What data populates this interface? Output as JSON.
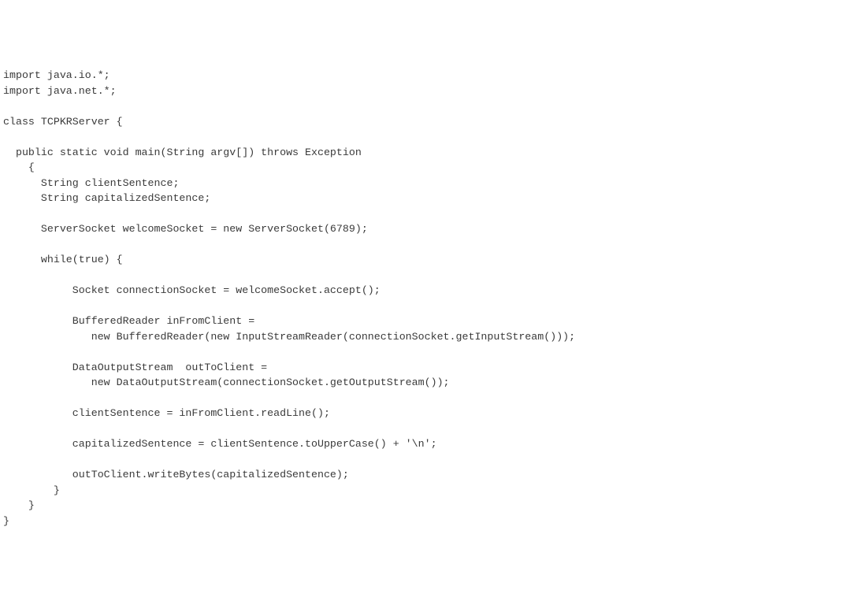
{
  "code": {
    "l1": "import java.io.*;",
    "l2": "import java.net.*;",
    "l3": "",
    "l4": "class TCPKRServer {",
    "l5": "",
    "l6": "  public static void main(String argv[]) throws Exception",
    "l7": "    {",
    "l8": "      String clientSentence;",
    "l9": "      String capitalizedSentence;",
    "l10": "",
    "l11": "      ServerSocket welcomeSocket = new ServerSocket(6789);",
    "l12": "",
    "l13": "      while(true) {",
    "l14": "",
    "l15": "           Socket connectionSocket = welcomeSocket.accept();",
    "l16": "",
    "l17": "           BufferedReader inFromClient =",
    "l18": "              new BufferedReader(new InputStreamReader(connectionSocket.getInputStream()));",
    "l19": "",
    "l20": "           DataOutputStream  outToClient =",
    "l21": "              new DataOutputStream(connectionSocket.getOutputStream());",
    "l22": "",
    "l23": "           clientSentence = inFromClient.readLine();",
    "l24": "",
    "l25": "           capitalizedSentence = clientSentence.toUpperCase() + '\\n';",
    "l26": "",
    "l27": "           outToClient.writeBytes(capitalizedSentence);",
    "l28": "        }",
    "l29": "    }",
    "l30": "}"
  }
}
